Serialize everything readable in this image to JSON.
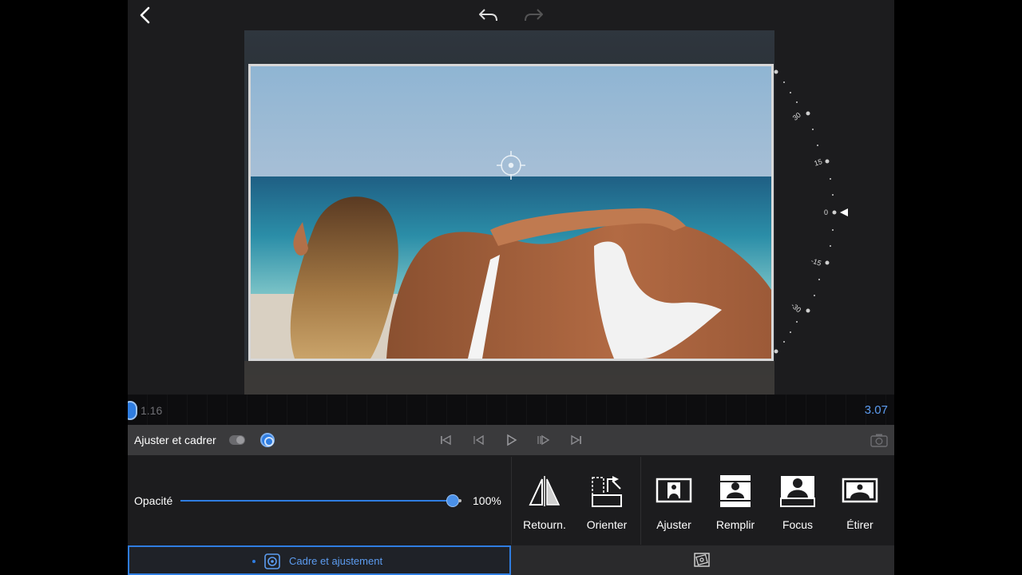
{
  "toolbar": {
    "back_icon": "chevron-left-icon",
    "undo_icon": "undo-icon",
    "redo_icon": "redo-icon"
  },
  "rotation_dial": {
    "labels": [
      "30",
      "15",
      "0",
      "-15",
      "-30"
    ],
    "current_value": 0
  },
  "timeline": {
    "start_time": "1.16",
    "end_time": "3.07"
  },
  "controls": {
    "panel_title": "Ajuster et cadrer",
    "transport_icons": [
      "skip-to-start-icon",
      "step-back-icon",
      "play-icon",
      "step-forward-icon",
      "skip-to-end-icon"
    ],
    "camera_icon": "camera-icon"
  },
  "opacity": {
    "label": "Opacité",
    "value_text": "100%",
    "value": 1.0
  },
  "tools": [
    {
      "label": "Retourn.",
      "icon": "flip-icon"
    },
    {
      "label": "Orienter",
      "icon": "orient-icon"
    },
    {
      "label": "Ajuster",
      "icon": "fit-icon"
    },
    {
      "label": "Remplir",
      "icon": "fill-icon"
    },
    {
      "label": "Focus",
      "icon": "focus-icon"
    },
    {
      "label": "Étirer",
      "icon": "stretch-icon"
    }
  ],
  "tabs": {
    "active_label": "Cadre et ajustement",
    "active_icon": "crop-adjust-icon",
    "other_icon": "transform-icon"
  },
  "colors": {
    "accent": "#2f7de1",
    "accent_text": "#5c9cf0",
    "background": "#1c1c1e",
    "controls_bar": "#3a3a3c"
  }
}
